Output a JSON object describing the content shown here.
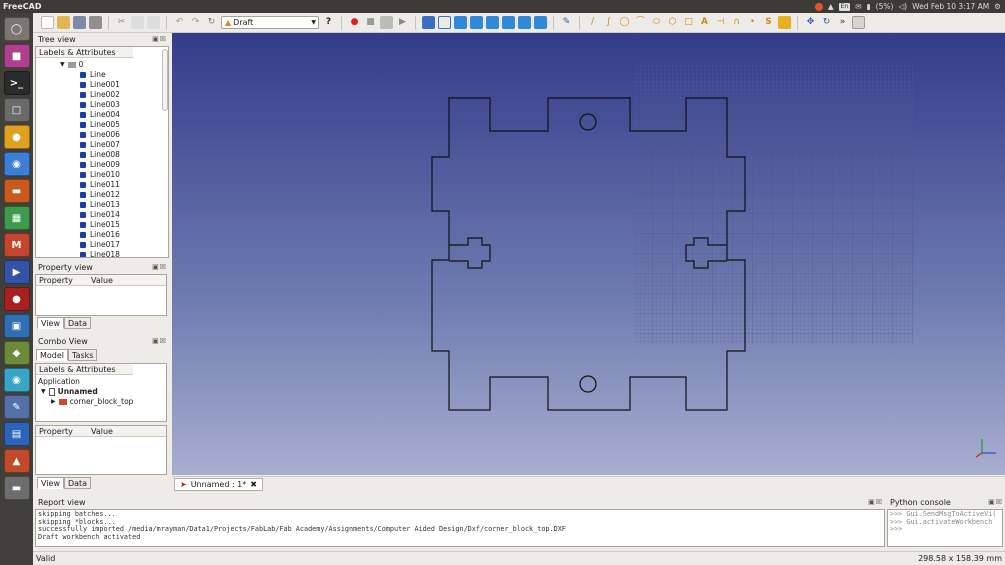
{
  "system_bar": {
    "app_name": "FreeCAD",
    "keyboard": "En",
    "battery": "(5%)",
    "clock": "Wed Feb 10  3:17 AM"
  },
  "toolbar": {
    "workbench": "Draft"
  },
  "tree_view": {
    "title": "Tree view",
    "header": "Labels & Attributes",
    "root_label": "0",
    "items": [
      "Line",
      "Line001",
      "Line002",
      "Line003",
      "Line004",
      "Line005",
      "Line006",
      "Line007",
      "Line008",
      "Line009",
      "Line010",
      "Line011",
      "Line012",
      "Line013",
      "Line014",
      "Line015",
      "Line016",
      "Line017",
      "Line018"
    ]
  },
  "property_view": {
    "title": "Property view",
    "col_property": "Property",
    "col_value": "Value",
    "tab_view": "View",
    "tab_data": "Data"
  },
  "combo_view": {
    "title": "Combo View",
    "tab_model": "Model",
    "tab_tasks": "Tasks",
    "header": "Labels & Attributes",
    "application": "Application",
    "document": "Unnamed",
    "object": "corner_block_top",
    "col_property": "Property",
    "col_value": "Value",
    "tab_view": "View",
    "tab_data": "Data"
  },
  "document_tab": {
    "label": "Unnamed : 1*"
  },
  "report_view": {
    "title": "Report view",
    "lines": [
      "skipping batches...",
      "skipping *blocks...",
      "successfully imported /media/mrayman/Data1/Projects/FabLab/Fab Academy/Assignments/Computer Aided Design/Dxf/corner_block_top.DXF",
      "Draft workbench activated"
    ]
  },
  "python_console": {
    "title": "Python console",
    "lines": [
      ">>> Gui.SendMsgToActiveVi(",
      ">>> Gui.activateWorkbench",
      ">>>"
    ]
  },
  "status": {
    "left": "Valid",
    "dimensions": "298.58 x 158.39 mm"
  },
  "colors": {
    "viewport_top": "#343b8a",
    "viewport_bottom": "#a7aed0",
    "tree_object": "#1b3fa8"
  }
}
